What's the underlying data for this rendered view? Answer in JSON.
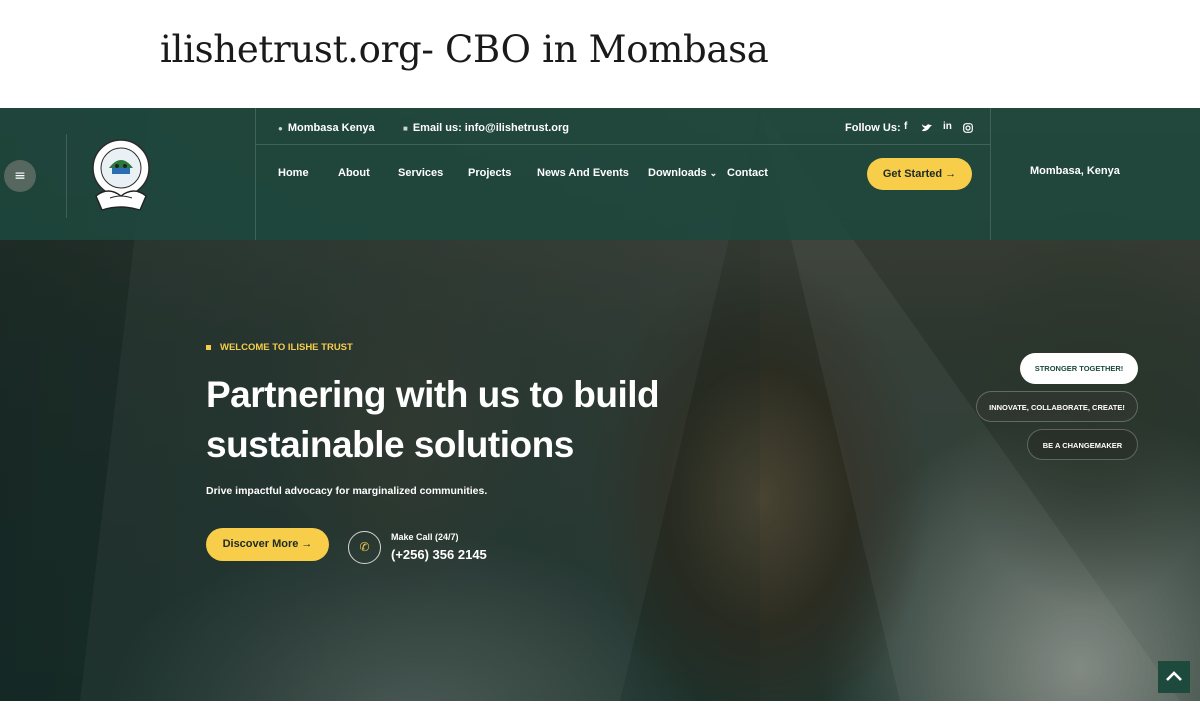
{
  "page_title": "ilishetrust.org- CBO in Mombasa",
  "header": {
    "location_info": "Mombasa Kenya",
    "email_info": "Email us: info@ilishetrust.org",
    "follow_label": "Follow Us:",
    "social": [
      "f",
      "twitter-icon",
      "in",
      "instagram-icon"
    ],
    "nav": [
      "Home",
      "About",
      "Services",
      "Projects",
      "News And Events",
      "Downloads",
      "Contact"
    ],
    "cta": "Get Started →",
    "location_right": "Mombasa, Kenya"
  },
  "hero": {
    "welcome": "WELCOME TO ILISHE TRUST",
    "headline": "Partnering with us to build sustainable solutions",
    "subtitle": "Drive impactful advocacy for marginalized communities.",
    "discover_button": "Discover More →",
    "call_label": "Make Call (24/7)",
    "call_number": "(+256) 356 2145",
    "pills": [
      "STRONGER TOGETHER!",
      "INNOVATE, COLLABORATE, CREATE!",
      "BE A CHANGEMAKER"
    ]
  },
  "colors": {
    "accent": "#f7cd4a",
    "header_bg": "#1e483e"
  }
}
